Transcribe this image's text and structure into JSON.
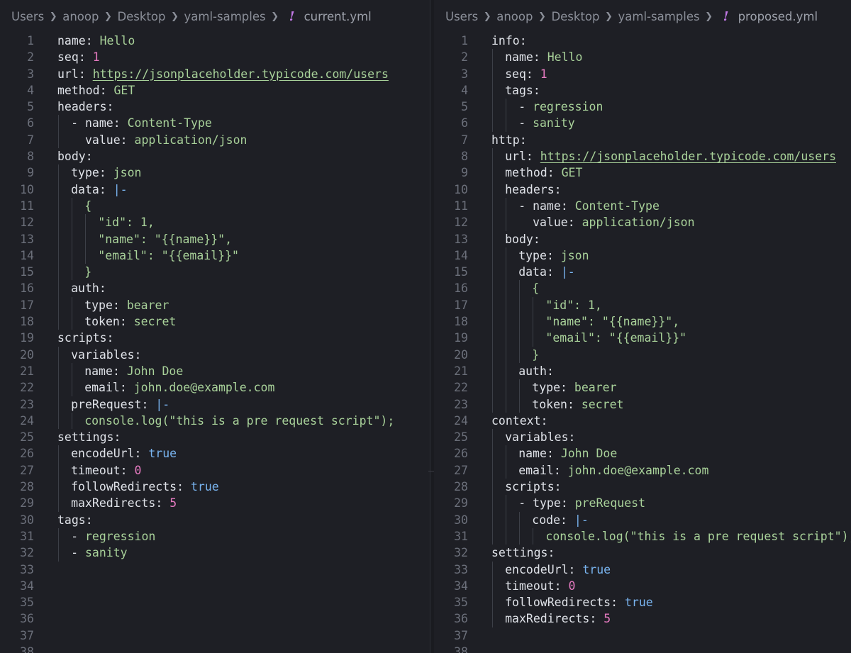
{
  "left": {
    "breadcrumb": [
      "Users",
      "anoop",
      "Desktop",
      "yaml-samples"
    ],
    "file_name": "current.yml",
    "total_lines": 38,
    "lines": [
      {
        "depth": 0,
        "parts": [
          [
            "key",
            "name"
          ],
          [
            "pun",
            ": "
          ],
          [
            "str",
            "Hello"
          ]
        ]
      },
      {
        "depth": 0,
        "parts": [
          [
            "key",
            "seq"
          ],
          [
            "pun",
            ": "
          ],
          [
            "num",
            "1"
          ]
        ]
      },
      {
        "depth": 0,
        "parts": [
          [
            "key",
            "url"
          ],
          [
            "pun",
            ": "
          ],
          [
            "url",
            "https://jsonplaceholder.typicode.com/users"
          ]
        ]
      },
      {
        "depth": 0,
        "parts": [
          [
            "key",
            "method"
          ],
          [
            "pun",
            ": "
          ],
          [
            "str",
            "GET"
          ]
        ]
      },
      {
        "depth": 0,
        "parts": [
          [
            "key",
            "headers"
          ],
          [
            "pun",
            ":"
          ]
        ]
      },
      {
        "depth": 1,
        "parts": [
          [
            "pun",
            "- "
          ],
          [
            "key",
            "name"
          ],
          [
            "pun",
            ": "
          ],
          [
            "str",
            "Content-Type"
          ]
        ]
      },
      {
        "depth": 1,
        "parts": [
          [
            "pun",
            "  "
          ],
          [
            "key",
            "value"
          ],
          [
            "pun",
            ": "
          ],
          [
            "str",
            "application/json"
          ]
        ]
      },
      {
        "depth": 0,
        "parts": [
          [
            "key",
            "body"
          ],
          [
            "pun",
            ":"
          ]
        ]
      },
      {
        "depth": 1,
        "parts": [
          [
            "key",
            "type"
          ],
          [
            "pun",
            ": "
          ],
          [
            "str",
            "json"
          ]
        ]
      },
      {
        "depth": 1,
        "parts": [
          [
            "key",
            "data"
          ],
          [
            "pun",
            ": "
          ],
          [
            "bool",
            "|-"
          ]
        ]
      },
      {
        "depth": 2,
        "parts": [
          [
            "str",
            "{"
          ]
        ]
      },
      {
        "depth": 3,
        "parts": [
          [
            "str",
            "\"id\": 1,"
          ]
        ]
      },
      {
        "depth": 3,
        "parts": [
          [
            "str",
            "\"name\": \"{{name}}\","
          ]
        ]
      },
      {
        "depth": 3,
        "parts": [
          [
            "str",
            "\"email\": \"{{email}}\""
          ]
        ]
      },
      {
        "depth": 2,
        "parts": [
          [
            "str",
            "}"
          ]
        ]
      },
      {
        "depth": 1,
        "parts": [
          [
            "key",
            "auth"
          ],
          [
            "pun",
            ":"
          ]
        ]
      },
      {
        "depth": 2,
        "parts": [
          [
            "key",
            "type"
          ],
          [
            "pun",
            ": "
          ],
          [
            "str",
            "bearer"
          ]
        ]
      },
      {
        "depth": 2,
        "parts": [
          [
            "key",
            "token"
          ],
          [
            "pun",
            ": "
          ],
          [
            "str",
            "secret"
          ]
        ]
      },
      {
        "depth": 0,
        "parts": [
          [
            "key",
            "scripts"
          ],
          [
            "pun",
            ":"
          ]
        ]
      },
      {
        "depth": 1,
        "parts": [
          [
            "key",
            "variables"
          ],
          [
            "pun",
            ":"
          ]
        ]
      },
      {
        "depth": 2,
        "parts": [
          [
            "key",
            "name"
          ],
          [
            "pun",
            ": "
          ],
          [
            "str",
            "John Doe"
          ]
        ]
      },
      {
        "depth": 2,
        "parts": [
          [
            "key",
            "email"
          ],
          [
            "pun",
            ": "
          ],
          [
            "str",
            "john.doe@example.com"
          ]
        ]
      },
      {
        "depth": 1,
        "parts": [
          [
            "key",
            "preRequest"
          ],
          [
            "pun",
            ": "
          ],
          [
            "bool",
            "|-"
          ]
        ]
      },
      {
        "depth": 2,
        "parts": [
          [
            "str",
            "console.log(\"this is a pre request script\");"
          ]
        ]
      },
      {
        "depth": 0,
        "parts": [
          [
            "key",
            "settings"
          ],
          [
            "pun",
            ":"
          ]
        ]
      },
      {
        "depth": 1,
        "parts": [
          [
            "key",
            "encodeUrl"
          ],
          [
            "pun",
            ": "
          ],
          [
            "bool",
            "true"
          ]
        ]
      },
      {
        "depth": 1,
        "parts": [
          [
            "key",
            "timeout"
          ],
          [
            "pun",
            ": "
          ],
          [
            "num",
            "0"
          ]
        ]
      },
      {
        "depth": 1,
        "parts": [
          [
            "key",
            "followRedirects"
          ],
          [
            "pun",
            ": "
          ],
          [
            "bool",
            "true"
          ]
        ]
      },
      {
        "depth": 1,
        "parts": [
          [
            "key",
            "maxRedirects"
          ],
          [
            "pun",
            ": "
          ],
          [
            "num",
            "5"
          ]
        ]
      },
      {
        "depth": 0,
        "parts": [
          [
            "key",
            "tags"
          ],
          [
            "pun",
            ":"
          ]
        ]
      },
      {
        "depth": 1,
        "parts": [
          [
            "pun",
            "- "
          ],
          [
            "str",
            "regression"
          ]
        ]
      },
      {
        "depth": 1,
        "parts": [
          [
            "pun",
            "- "
          ],
          [
            "str",
            "sanity"
          ]
        ]
      }
    ]
  },
  "right": {
    "breadcrumb": [
      "Users",
      "anoop",
      "Desktop",
      "yaml-samples"
    ],
    "file_name": "proposed.yml",
    "total_lines": 38,
    "lines": [
      {
        "depth": 0,
        "parts": [
          [
            "key",
            "info"
          ],
          [
            "pun",
            ":"
          ]
        ]
      },
      {
        "depth": 1,
        "parts": [
          [
            "key",
            "name"
          ],
          [
            "pun",
            ": "
          ],
          [
            "str",
            "Hello"
          ]
        ]
      },
      {
        "depth": 1,
        "parts": [
          [
            "key",
            "seq"
          ],
          [
            "pun",
            ": "
          ],
          [
            "num",
            "1"
          ]
        ]
      },
      {
        "depth": 1,
        "parts": [
          [
            "key",
            "tags"
          ],
          [
            "pun",
            ":"
          ]
        ]
      },
      {
        "depth": 2,
        "parts": [
          [
            "pun",
            "- "
          ],
          [
            "str",
            "regression"
          ]
        ]
      },
      {
        "depth": 2,
        "parts": [
          [
            "pun",
            "- "
          ],
          [
            "str",
            "sanity"
          ]
        ]
      },
      {
        "depth": 0,
        "parts": [
          [
            "key",
            "http"
          ],
          [
            "pun",
            ":"
          ]
        ]
      },
      {
        "depth": 1,
        "parts": [
          [
            "key",
            "url"
          ],
          [
            "pun",
            ": "
          ],
          [
            "url",
            "https://jsonplaceholder.typicode.com/users"
          ]
        ]
      },
      {
        "depth": 1,
        "parts": [
          [
            "key",
            "method"
          ],
          [
            "pun",
            ": "
          ],
          [
            "str",
            "GET"
          ]
        ]
      },
      {
        "depth": 1,
        "parts": [
          [
            "key",
            "headers"
          ],
          [
            "pun",
            ":"
          ]
        ]
      },
      {
        "depth": 2,
        "parts": [
          [
            "pun",
            "- "
          ],
          [
            "key",
            "name"
          ],
          [
            "pun",
            ": "
          ],
          [
            "str",
            "Content-Type"
          ]
        ]
      },
      {
        "depth": 2,
        "parts": [
          [
            "pun",
            "  "
          ],
          [
            "key",
            "value"
          ],
          [
            "pun",
            ": "
          ],
          [
            "str",
            "application/json"
          ]
        ]
      },
      {
        "depth": 1,
        "parts": [
          [
            "key",
            "body"
          ],
          [
            "pun",
            ":"
          ]
        ]
      },
      {
        "depth": 2,
        "parts": [
          [
            "key",
            "type"
          ],
          [
            "pun",
            ": "
          ],
          [
            "str",
            "json"
          ]
        ]
      },
      {
        "depth": 2,
        "parts": [
          [
            "key",
            "data"
          ],
          [
            "pun",
            ": "
          ],
          [
            "bool",
            "|-"
          ]
        ]
      },
      {
        "depth": 3,
        "parts": [
          [
            "str",
            "{"
          ]
        ]
      },
      {
        "depth": 4,
        "parts": [
          [
            "str",
            "\"id\": 1,"
          ]
        ]
      },
      {
        "depth": 4,
        "parts": [
          [
            "str",
            "\"name\": \"{{name}}\","
          ]
        ]
      },
      {
        "depth": 4,
        "parts": [
          [
            "str",
            "\"email\": \"{{email}}\""
          ]
        ]
      },
      {
        "depth": 3,
        "parts": [
          [
            "str",
            "}"
          ]
        ]
      },
      {
        "depth": 2,
        "parts": [
          [
            "key",
            "auth"
          ],
          [
            "pun",
            ":"
          ]
        ]
      },
      {
        "depth": 3,
        "parts": [
          [
            "key",
            "type"
          ],
          [
            "pun",
            ": "
          ],
          [
            "str",
            "bearer"
          ]
        ]
      },
      {
        "depth": 3,
        "parts": [
          [
            "key",
            "token"
          ],
          [
            "pun",
            ": "
          ],
          [
            "str",
            "secret"
          ]
        ]
      },
      {
        "depth": 0,
        "parts": [
          [
            "key",
            "context"
          ],
          [
            "pun",
            ":"
          ]
        ]
      },
      {
        "depth": 1,
        "parts": [
          [
            "key",
            "variables"
          ],
          [
            "pun",
            ":"
          ]
        ]
      },
      {
        "depth": 2,
        "parts": [
          [
            "key",
            "name"
          ],
          [
            "pun",
            ": "
          ],
          [
            "str",
            "John Doe"
          ]
        ]
      },
      {
        "depth": 2,
        "parts": [
          [
            "key",
            "email"
          ],
          [
            "pun",
            ": "
          ],
          [
            "str",
            "john.doe@example.com"
          ]
        ]
      },
      {
        "depth": 1,
        "parts": [
          [
            "key",
            "scripts"
          ],
          [
            "pun",
            ":"
          ]
        ]
      },
      {
        "depth": 2,
        "parts": [
          [
            "pun",
            "- "
          ],
          [
            "key",
            "type"
          ],
          [
            "pun",
            ": "
          ],
          [
            "str",
            "preRequest"
          ]
        ]
      },
      {
        "depth": 3,
        "parts": [
          [
            "key",
            "code"
          ],
          [
            "pun",
            ": "
          ],
          [
            "bool",
            "|-"
          ]
        ]
      },
      {
        "depth": 4,
        "parts": [
          [
            "str",
            "console.log(\"this is a pre request script\");"
          ]
        ]
      },
      {
        "depth": 0,
        "parts": [
          [
            "key",
            "settings"
          ],
          [
            "pun",
            ":"
          ]
        ]
      },
      {
        "depth": 1,
        "parts": [
          [
            "key",
            "encodeUrl"
          ],
          [
            "pun",
            ": "
          ],
          [
            "bool",
            "true"
          ]
        ]
      },
      {
        "depth": 1,
        "parts": [
          [
            "key",
            "timeout"
          ],
          [
            "pun",
            ": "
          ],
          [
            "num",
            "0"
          ]
        ]
      },
      {
        "depth": 1,
        "parts": [
          [
            "key",
            "followRedirects"
          ],
          [
            "pun",
            ": "
          ],
          [
            "bool",
            "true"
          ]
        ]
      },
      {
        "depth": 1,
        "parts": [
          [
            "key",
            "maxRedirects"
          ],
          [
            "pun",
            ": "
          ],
          [
            "num",
            "5"
          ]
        ]
      }
    ]
  }
}
